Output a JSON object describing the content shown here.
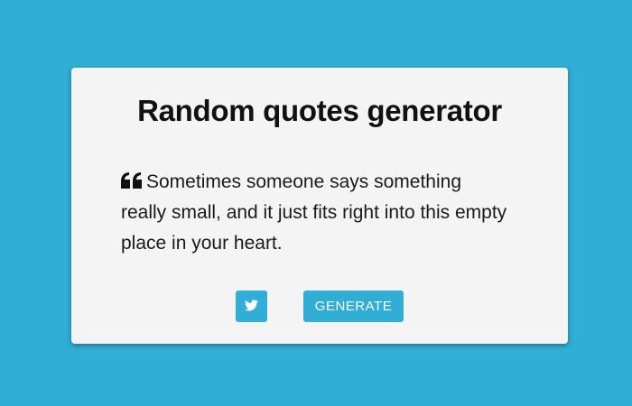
{
  "page": {
    "background_color": "#30aed6",
    "card_color": "#f4f4f4"
  },
  "header": {
    "title": "Random quotes generator"
  },
  "quote": {
    "icon": "quote-left-icon",
    "text": "Sometimes someone says something really small, and it just fits right into this empty place in your heart."
  },
  "actions": {
    "tweet_icon": "twitter-icon",
    "generate_label": "GENERATE",
    "button_color": "#30aed6"
  }
}
